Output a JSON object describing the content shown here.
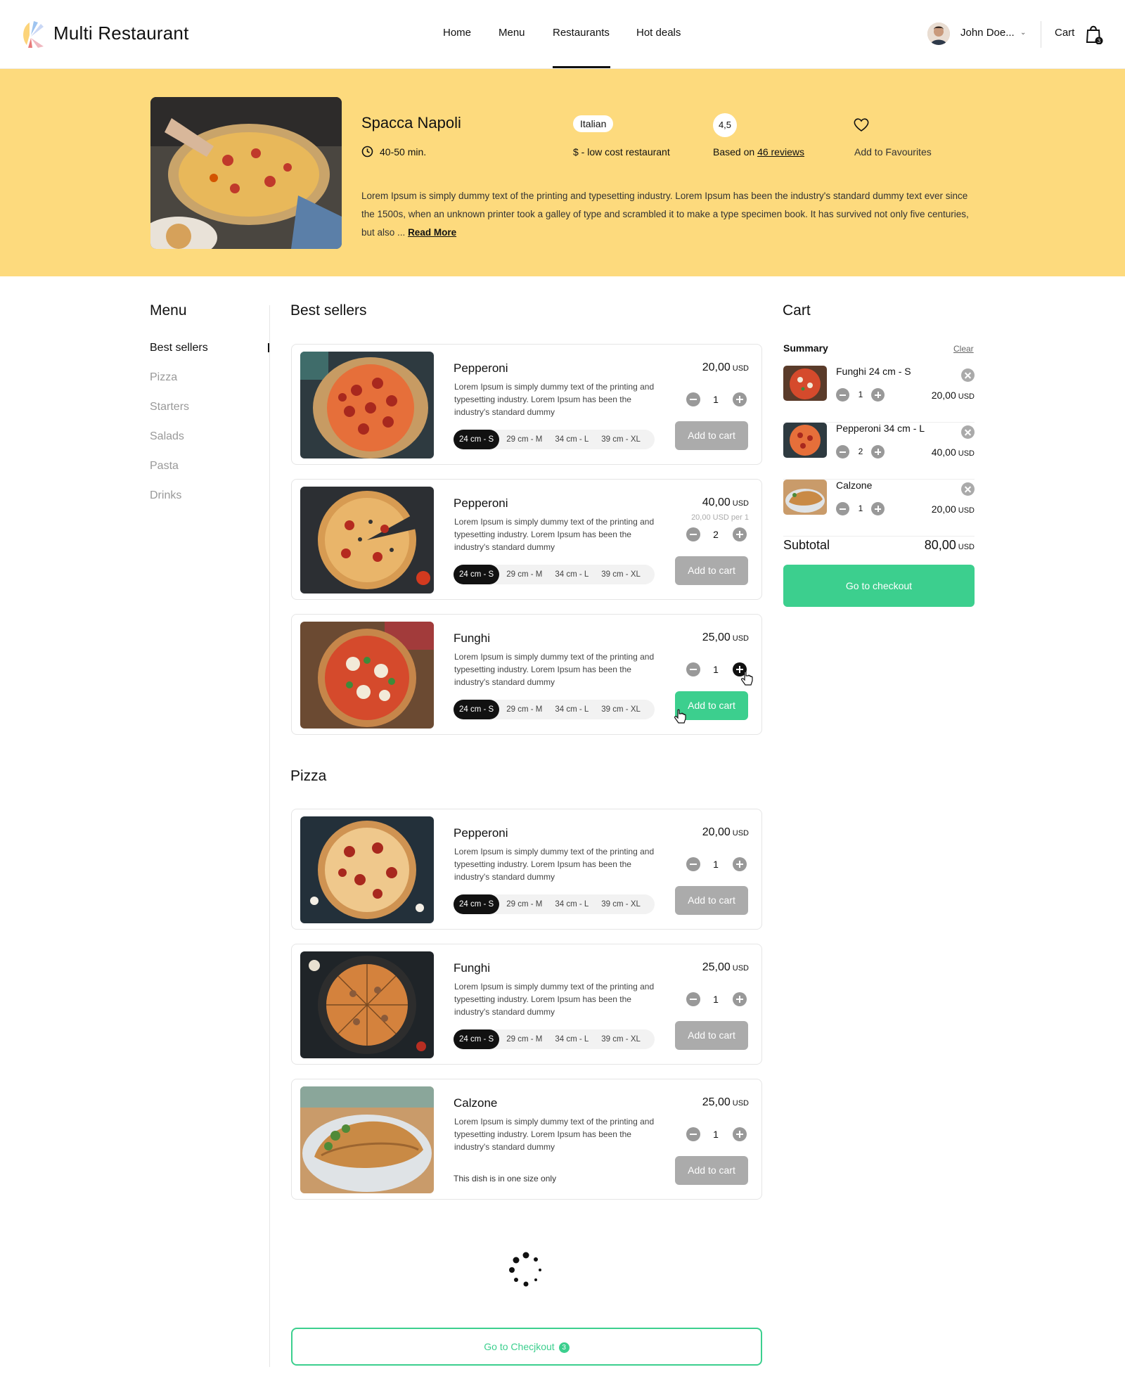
{
  "header": {
    "brand": "Multi Restaurant",
    "nav": [
      "Home",
      "Menu",
      "Restaurants",
      "Hot deals"
    ],
    "active_nav": "Restaurants",
    "user_name": "John Doe...",
    "cart_label": "Cart",
    "cart_count": "3"
  },
  "restaurant": {
    "name": "Spacca Napoli",
    "delivery_time": "40-50 min.",
    "cuisine": "Italian",
    "price_level": "$ - low cost restaurant",
    "rating": "4,5",
    "rating_prefix": "Based on",
    "reviews_link": "46 reviews",
    "favourite_label": "Add to Favourites",
    "description": "Lorem Ipsum is simply dummy text of the printing and typesetting industry. Lorem Ipsum has been the industry's standard dummy text ever since the 1500s, when an unknown printer took a galley of type and scrambled it to make a type specimen book. It has survived not only five centuries, but also ...",
    "read_more": "Read More"
  },
  "menu": {
    "title": "Menu",
    "items": [
      "Best sellers",
      "Pizza",
      "Starters",
      "Salads",
      "Pasta",
      "Drinks"
    ],
    "active": "Best sellers"
  },
  "sections": [
    {
      "title": "Best sellers",
      "products": [
        {
          "name": "Pepperoni",
          "description": "Lorem Ipsum is simply dummy text of the printing and typesetting industry. Lorem Ipsum has been the industry's standard dummy",
          "price": "20,00",
          "currency": "USD",
          "quantity": "1",
          "sizes": [
            "24 cm - S",
            "29 cm - M",
            "34 cm - L",
            "39 cm - XL"
          ],
          "selected_size": "24 cm - S",
          "add_label": "Add to cart"
        },
        {
          "name": "Pepperoni",
          "description": "Lorem Ipsum is simply dummy text of the printing and typesetting industry. Lorem Ipsum has been the industry's standard dummy",
          "price": "40,00",
          "currency": "USD",
          "per_note": "20,00 USD per 1",
          "quantity": "2",
          "sizes": [
            "24 cm - S",
            "29 cm - M",
            "34 cm - L",
            "39 cm - XL"
          ],
          "selected_size": "24 cm - S",
          "add_label": "Add to cart"
        },
        {
          "name": "Funghi",
          "description": "Lorem Ipsum is simply dummy text of the printing and typesetting industry. Lorem Ipsum has been the industry's standard dummy",
          "price": "25,00",
          "currency": "USD",
          "quantity": "1",
          "sizes": [
            "24 cm - S",
            "29 cm - M",
            "34 cm - L",
            "39 cm - XL"
          ],
          "selected_size": "24 cm - S",
          "add_label": "Add to cart"
        }
      ]
    },
    {
      "title": "Pizza",
      "products": [
        {
          "name": "Pepperoni",
          "description": "Lorem Ipsum is simply dummy text of the printing and typesetting industry. Lorem Ipsum has been the industry's standard dummy",
          "price": "20,00",
          "currency": "USD",
          "quantity": "1",
          "sizes": [
            "24 cm - S",
            "29 cm - M",
            "34 cm - L",
            "39 cm - XL"
          ],
          "selected_size": "24 cm - S",
          "add_label": "Add to cart"
        },
        {
          "name": "Funghi",
          "description": "Lorem Ipsum is simply dummy text of the printing and typesetting industry. Lorem Ipsum has been the industry's standard dummy",
          "price": "25,00",
          "currency": "USD",
          "quantity": "1",
          "sizes": [
            "24 cm - S",
            "29 cm - M",
            "34 cm - L",
            "39 cm - XL"
          ],
          "selected_size": "24 cm - S",
          "add_label": "Add to cart"
        },
        {
          "name": "Calzone",
          "description": "Lorem Ipsum is simply dummy text of the printing and typesetting industry. Lorem Ipsum has been the industry's standard dummy",
          "price": "25,00",
          "currency": "USD",
          "quantity": "1",
          "single_size_note": "This dish is in one size only",
          "add_label": "Add to cart"
        }
      ]
    }
  ],
  "cart": {
    "title": "Cart",
    "summary_label": "Summary",
    "clear_label": "Clear",
    "items": [
      {
        "name": "Funghi 24 cm - S",
        "quantity": "1",
        "price": "20,00",
        "currency": "USD"
      },
      {
        "name": "Pepperoni 34 cm - L",
        "quantity": "2",
        "price": "40,00",
        "currency": "USD"
      },
      {
        "name": "Calzone",
        "quantity": "1",
        "price": "20,00",
        "currency": "USD"
      }
    ],
    "subtotal_label": "Subtotal",
    "subtotal": "80,00",
    "currency": "USD",
    "checkout_label": "Go to checkout"
  },
  "bottom_checkout": {
    "label": "Go to Checjkout",
    "badge": "3"
  },
  "colors": {
    "hero_bg": "#fdda7d",
    "accent_green": "#3ccf8e",
    "disabled_button": "#ababab",
    "text_dark": "#111111",
    "text_muted": "#999999"
  },
  "icons": [
    "clock-icon",
    "heart-icon",
    "cart-bag-icon",
    "minus-icon",
    "plus-icon",
    "remove-icon",
    "loading-spinner-icon",
    "hand-pointer-icon"
  ]
}
